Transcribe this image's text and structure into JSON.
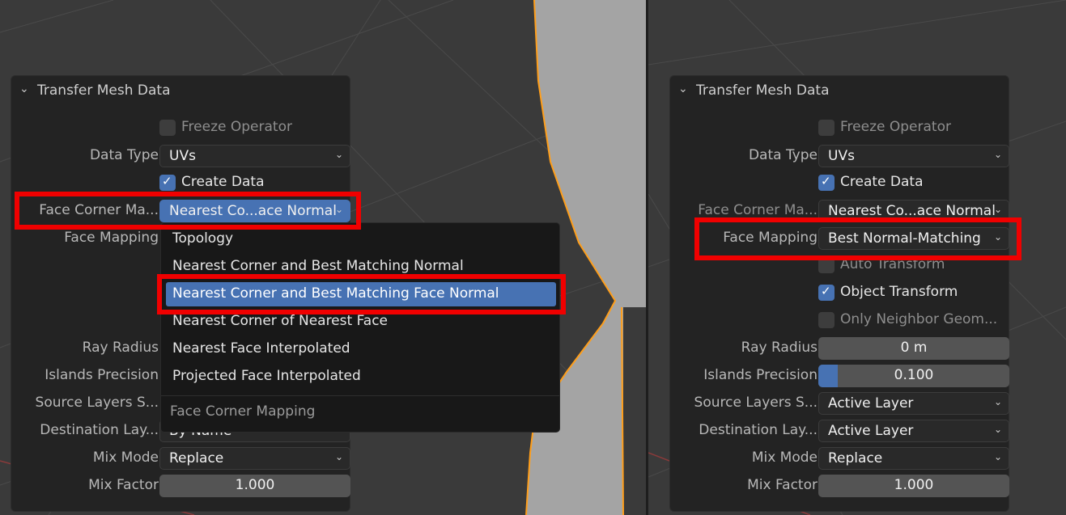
{
  "colors": {
    "accent": "#4772b3",
    "highlight": "#f00000",
    "panel_bg": "#232323",
    "viewport_bg": "#3a3a3a",
    "selection_outline": "#ff9e1a"
  },
  "left_panel": {
    "title": "Transfer Mesh Data",
    "freeze_operator": {
      "label": "Freeze Operator",
      "checked": false
    },
    "data_type": {
      "label": "Data Type",
      "value": "UVs"
    },
    "create_data": {
      "label": "Create Data",
      "checked": true
    },
    "face_corner_mapping": {
      "label": "Face Corner Ma...",
      "value": "Nearest Co...ace Normal"
    },
    "face_mapping": {
      "label": "Face Mapping"
    },
    "ray_radius": {
      "label": "Ray Radius"
    },
    "islands_precision": {
      "label": "Islands Precision"
    },
    "source_layers": {
      "label": "Source Layers S..."
    },
    "destination_layers": {
      "label": "Destination Lay...",
      "value": "By Name"
    },
    "mix_mode": {
      "label": "Mix Mode",
      "value": "Replace"
    },
    "mix_factor": {
      "label": "Mix Factor",
      "value": "1.000"
    }
  },
  "dropdown_menu": {
    "items": [
      "Topology",
      "Nearest Corner and Best Matching Normal",
      "Nearest Corner and Best Matching Face Normal",
      "Nearest Corner of Nearest Face",
      "Nearest Face Interpolated",
      "Projected Face Interpolated"
    ],
    "selected_index": 2,
    "footer": "Face Corner Mapping"
  },
  "right_panel": {
    "title": "Transfer Mesh Data",
    "freeze_operator": {
      "label": "Freeze Operator",
      "checked": false
    },
    "data_type": {
      "label": "Data Type",
      "value": "UVs"
    },
    "create_data": {
      "label": "Create Data",
      "checked": true
    },
    "face_corner_mapping": {
      "label": "Face Corner Ma...",
      "value": "Nearest Co...ace Normal"
    },
    "face_mapping": {
      "label": "Face Mapping",
      "value": "Best Normal-Matching"
    },
    "auto_transform": {
      "label": "Auto Transform",
      "checked": false
    },
    "object_transform": {
      "label": "Object Transform",
      "checked": true
    },
    "only_neighbor_geometry": {
      "label": "Only Neighbor Geom...",
      "checked": false
    },
    "ray_radius": {
      "label": "Ray Radius",
      "value": "0 m"
    },
    "islands_precision": {
      "label": "Islands Precision",
      "value": "0.100",
      "fraction": 0.1
    },
    "source_layers": {
      "label": "Source Layers S...",
      "value": "Active Layer"
    },
    "destination_layers": {
      "label": "Destination Lay...",
      "value": "Active Layer"
    },
    "mix_mode": {
      "label": "Mix Mode",
      "value": "Replace"
    },
    "mix_factor": {
      "label": "Mix Factor",
      "value": "1.000"
    }
  }
}
